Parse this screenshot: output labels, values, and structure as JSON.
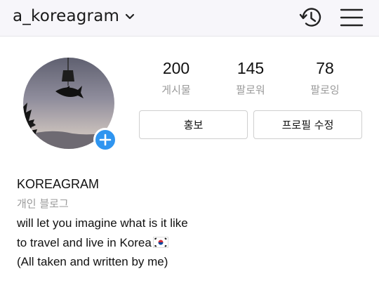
{
  "header": {
    "username": "a_koreagram",
    "icons": [
      "chevron-down-icon",
      "history-icon",
      "menu-icon"
    ]
  },
  "profile": {
    "stats": [
      {
        "value": "200",
        "label": "게시물"
      },
      {
        "value": "145",
        "label": "팔로워"
      },
      {
        "value": "78",
        "label": "팔로잉"
      }
    ],
    "buttons": {
      "promote": "홍보",
      "edit_profile": "프로필 수정"
    }
  },
  "bio": {
    "name": "KOREAGRAM",
    "category": "개인 블로그",
    "lines": [
      "will let you imagine what is it like",
      "to travel and live in Korea",
      "(All taken and written by me)"
    ],
    "flag_icon": "south-korea-flag-icon"
  },
  "colors": {
    "accent": "#2f95f0",
    "secondary_text": "#9a9a9a",
    "topbar_bg": "#f7f6fa"
  }
}
